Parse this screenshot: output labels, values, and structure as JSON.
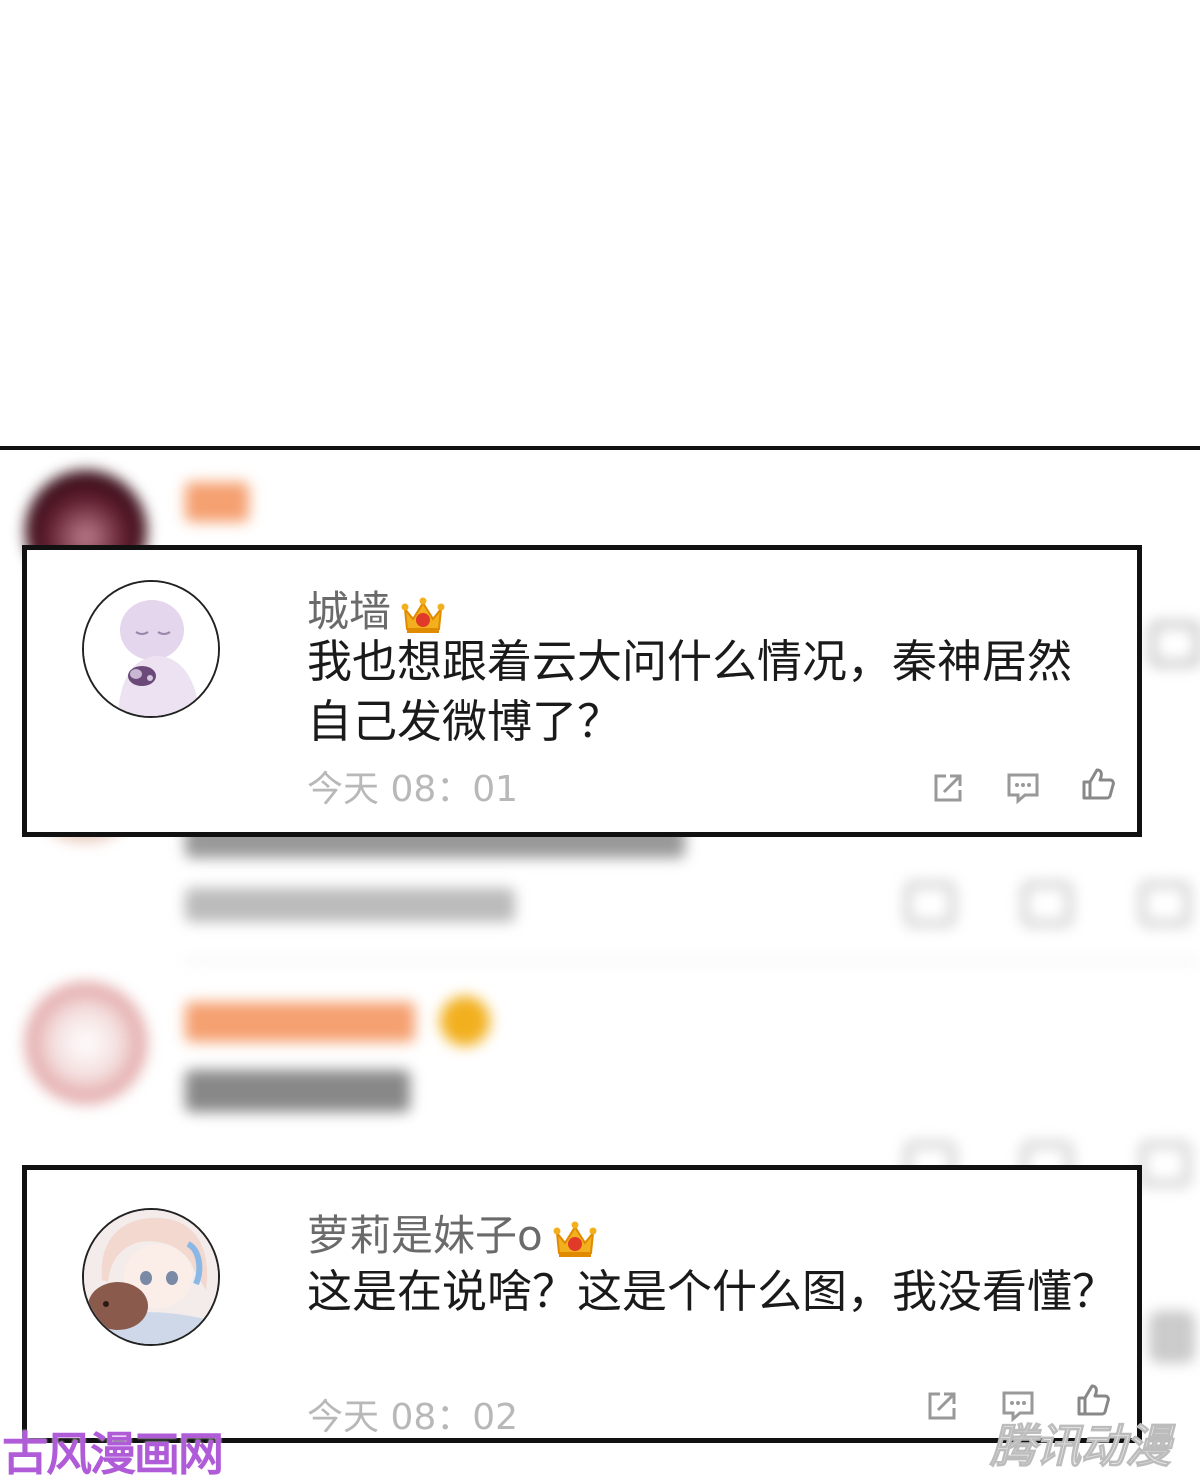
{
  "comments": [
    {
      "username": "城墙",
      "text": "我也想跟着云大问什么情况，秦神居然自己发微博了？",
      "time": "今天  08：01",
      "avatar": "pale-character-avatar",
      "badge": "crown-icon",
      "icons": [
        "share-icon",
        "comment-icon",
        "like-icon"
      ]
    },
    {
      "username": "萝莉是妹子o",
      "text": "这是在说啥？这是个什么图，我没看懂？",
      "time": "今天  08：02",
      "avatar": "anime-girl-avatar",
      "badge": "crown-icon",
      "icons": [
        "share-icon",
        "comment-icon",
        "like-icon"
      ]
    }
  ],
  "watermarks": {
    "left": "古风漫画网",
    "right": "腾讯动漫"
  },
  "colors": {
    "username": "#6a6a6a",
    "text": "#1a1a1a",
    "time": "#b8b8b8",
    "crown": "#f2b01e",
    "blurred_name": "#f07e3a",
    "watermark_left": "#b05cd8"
  }
}
